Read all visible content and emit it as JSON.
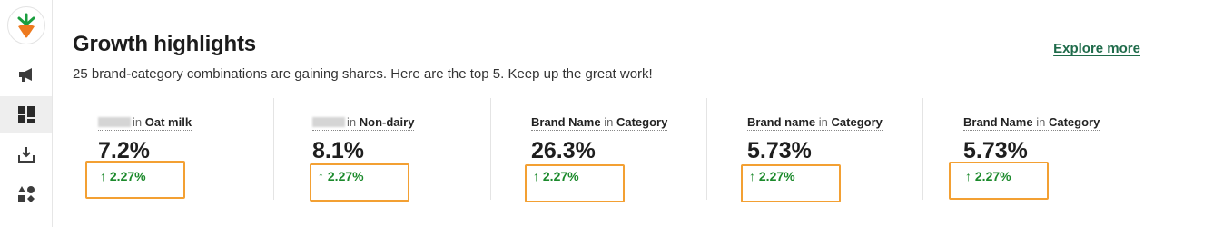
{
  "section": {
    "title": "Growth highlights",
    "subtitle": "25 brand-category combinations are gaining shares. Here are the top 5. Keep up the great work!",
    "explore_label": "Explore more"
  },
  "in_word": "in",
  "highlights": [
    {
      "brand": "",
      "category": "Oat milk",
      "value": "7.2%",
      "change": "↑ 2.27%"
    },
    {
      "brand": "",
      "category": "Non-dairy",
      "value": "8.1%",
      "change": "↑ 2.27%"
    },
    {
      "brand": "Brand Name",
      "category": "Category",
      "value": "26.3%",
      "change": "↑ 2.27%"
    },
    {
      "brand": "Brand name",
      "category": "Category",
      "value": "5.73%",
      "change": "↑ 2.27%"
    },
    {
      "brand": "Brand Name",
      "category": "Category",
      "value": "5.73%",
      "change": "↑ 2.27%"
    }
  ],
  "colors": {
    "accent": "#1f6b4a",
    "positive": "#1c8a2c",
    "highlight_box": "#f3a033"
  }
}
